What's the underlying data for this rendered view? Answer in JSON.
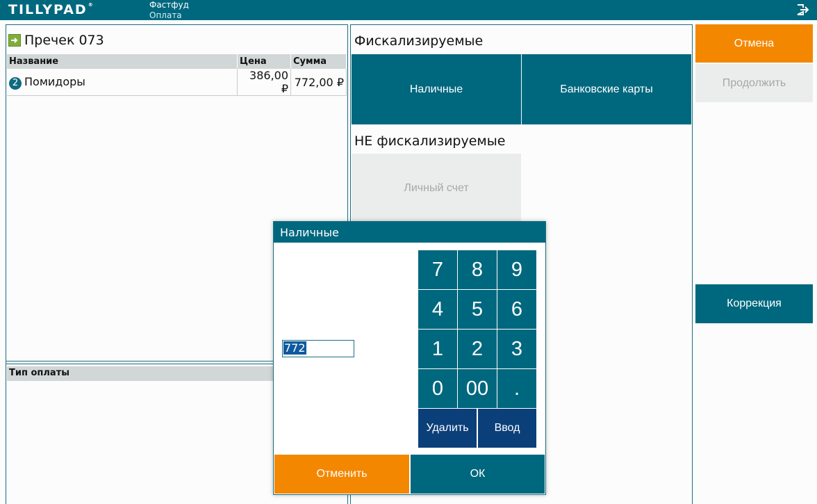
{
  "app": {
    "logo": "TILLYPAD",
    "logo_mark": "®",
    "section": "Фастфуд",
    "page": "Оплата"
  },
  "order": {
    "title": "Пречек 073",
    "columns": [
      "Название",
      "Цена",
      "Сумма"
    ],
    "rows": [
      {
        "qty": "2",
        "name": "Помидоры",
        "price": "386,00 ₽",
        "sum": "772,00 ₽"
      }
    ]
  },
  "payment_type": {
    "header": "Тип оплаты"
  },
  "fiscal": {
    "title": "Фискализируемые",
    "buttons": [
      "Наличные",
      "Банковские карты"
    ]
  },
  "nonfiscal": {
    "title": "НЕ фискализируемые",
    "buttons": [
      "Личный счет"
    ]
  },
  "actions": {
    "cancel": "Отмена",
    "continue": "Продолжить",
    "correction": "Коррекция"
  },
  "colors": {
    "teal": "#00687e",
    "orange": "#f48700",
    "navy": "#0b3f7a"
  },
  "dialog": {
    "title": "Наличные",
    "amount": "772",
    "keys": [
      "7",
      "8",
      "9",
      "4",
      "5",
      "6",
      "1",
      "2",
      "3",
      "0",
      "00",
      "."
    ],
    "delete_label": "Удалить",
    "enter_label": "Ввод",
    "cancel_label": "Отменить",
    "ok_label": "ОК"
  }
}
